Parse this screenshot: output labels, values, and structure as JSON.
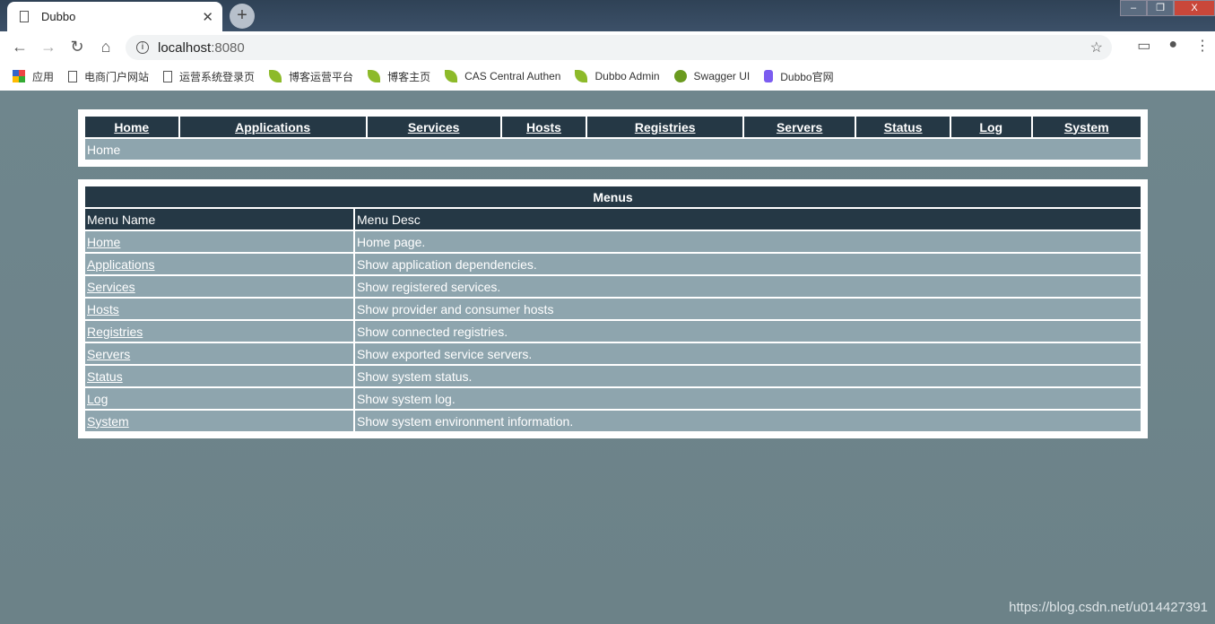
{
  "browser": {
    "tab_title": "Dubbo",
    "url_host": "localhost",
    "url_port": ":8080",
    "bookmarks": [
      {
        "label": "应用",
        "icon": "apps-icon"
      },
      {
        "label": "电商门户网站",
        "icon": "page-icon"
      },
      {
        "label": "运营系统登录页",
        "icon": "page-icon"
      },
      {
        "label": "博客运营平台",
        "icon": "spring-leaf-icon"
      },
      {
        "label": "博客主页",
        "icon": "spring-leaf-icon"
      },
      {
        "label": "CAS Central Authen",
        "icon": "spring-leaf-icon"
      },
      {
        "label": "Dubbo Admin",
        "icon": "spring-leaf-icon"
      },
      {
        "label": "Swagger UI",
        "icon": "swagger-icon"
      },
      {
        "label": "Dubbo官网",
        "icon": "dubbo-icon"
      }
    ]
  },
  "nav": [
    "Home",
    "Applications",
    "Services",
    "Hosts",
    "Registries",
    "Servers",
    "Status",
    "Log",
    "System"
  ],
  "breadcrumb": "Home",
  "menus": {
    "title": "Menus",
    "headers": [
      "Menu Name",
      "Menu Desc"
    ],
    "rows": [
      {
        "name": "Home",
        "desc": "Home page."
      },
      {
        "name": "Applications",
        "desc": "Show application dependencies."
      },
      {
        "name": "Services",
        "desc": "Show registered services."
      },
      {
        "name": "Hosts",
        "desc": "Show provider and consumer hosts"
      },
      {
        "name": "Registries",
        "desc": "Show connected registries."
      },
      {
        "name": "Servers",
        "desc": "Show exported service servers."
      },
      {
        "name": "Status",
        "desc": "Show system status."
      },
      {
        "name": "Log",
        "desc": "Show system log."
      },
      {
        "name": "System",
        "desc": "Show system environment information."
      }
    ]
  },
  "watermark": "https://blog.csdn.net/u014427391",
  "colors": {
    "header": "#253845",
    "row": "#8ea5ae",
    "page_bg": "#6f858c"
  }
}
